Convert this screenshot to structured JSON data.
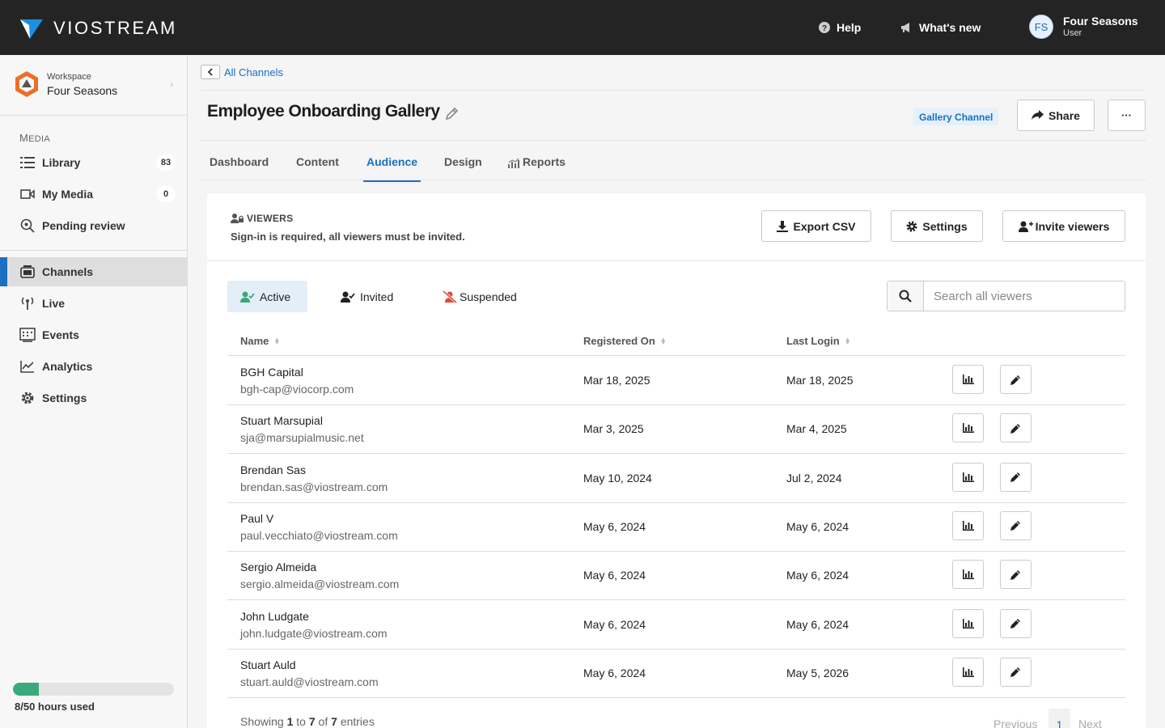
{
  "topbar": {
    "brand": "VIOSTREAM",
    "help": "Help",
    "whats_new": "What's new",
    "user": {
      "initials": "FS",
      "name": "Four Seasons",
      "role": "User"
    }
  },
  "sidebar": {
    "workspace_label": "Workspace",
    "workspace_name": "Four Seasons",
    "section_label_cap": "M",
    "section_label_rest": "EDIA",
    "media_items": [
      {
        "label": "Library",
        "count": "83",
        "icon": "list-icon"
      },
      {
        "label": "My Media",
        "count": "0",
        "icon": "video-icon"
      },
      {
        "label": "Pending review",
        "icon": "search-review-icon"
      }
    ],
    "nav_items": [
      {
        "label": "Channels",
        "icon": "channels-icon",
        "active": true
      },
      {
        "label": "Live",
        "icon": "broadcast-icon"
      },
      {
        "label": "Events",
        "icon": "events-icon"
      },
      {
        "label": "Analytics",
        "icon": "analytics-icon"
      },
      {
        "label": "Settings",
        "icon": "gear-icon"
      }
    ],
    "usage_label": "8/50 hours used",
    "usage_fraction": 0.16
  },
  "main": {
    "breadcrumb": "All Channels",
    "title": "Employee Onboarding Gallery",
    "badge": "Gallery Channel",
    "share_label": "Share",
    "more_label": "···",
    "tabs": [
      {
        "label": "Dashboard"
      },
      {
        "label": "Content"
      },
      {
        "label": "Audience",
        "active": true
      },
      {
        "label": "Design"
      },
      {
        "label": "Reports"
      }
    ],
    "viewers": {
      "heading": "VIEWERS",
      "subtitle": "Sign-in is required, all viewers must be invited.",
      "export_label": "Export CSV",
      "settings_label": "Settings",
      "invite_label": "Invite viewers",
      "filters": [
        "Active",
        "Invited",
        "Suspended"
      ],
      "search_placeholder": "Search all viewers",
      "columns": [
        "Name",
        "Registered On",
        "Last Login"
      ],
      "rows": [
        {
          "name": "BGH Capital",
          "email": "bgh-cap@viocorp.com",
          "registered": "Mar 18, 2025",
          "last_login": "Mar 18, 2025"
        },
        {
          "name": "Stuart Marsupial",
          "email": "sja@marsupialmusic.net",
          "registered": "Mar 3, 2025",
          "last_login": "Mar 4, 2025"
        },
        {
          "name": "Brendan Sas",
          "email": "brendan.sas@viostream.com",
          "registered": "May 10, 2024",
          "last_login": "Jul 2, 2024"
        },
        {
          "name": "Paul V",
          "email": "paul.vecchiato@viostream.com",
          "registered": "May 6, 2024",
          "last_login": "May 6, 2024"
        },
        {
          "name": "Sergio Almeida",
          "email": "sergio.almeida@viostream.com",
          "registered": "May 6, 2024",
          "last_login": "May 6, 2024"
        },
        {
          "name": "John Ludgate",
          "email": "john.ludgate@viostream.com",
          "registered": "May 6, 2024",
          "last_login": "May 6, 2024"
        },
        {
          "name": "Stuart Auld",
          "email": "stuart.auld@viostream.com",
          "registered": "May 6, 2024",
          "last_login": "May 5, 2026"
        }
      ],
      "showing_prefix": "Showing",
      "showing_from": "1",
      "showing_to_word": "to",
      "showing_to": "7",
      "showing_of_word": "of",
      "showing_total": "7",
      "showing_suffix": "entries",
      "pager_prev": "Previous",
      "pager_page": "1",
      "pager_next": "Next"
    }
  },
  "colors": {
    "accent": "#1a6fc1",
    "topbar": "#242424",
    "usage": "#3aa97b"
  }
}
